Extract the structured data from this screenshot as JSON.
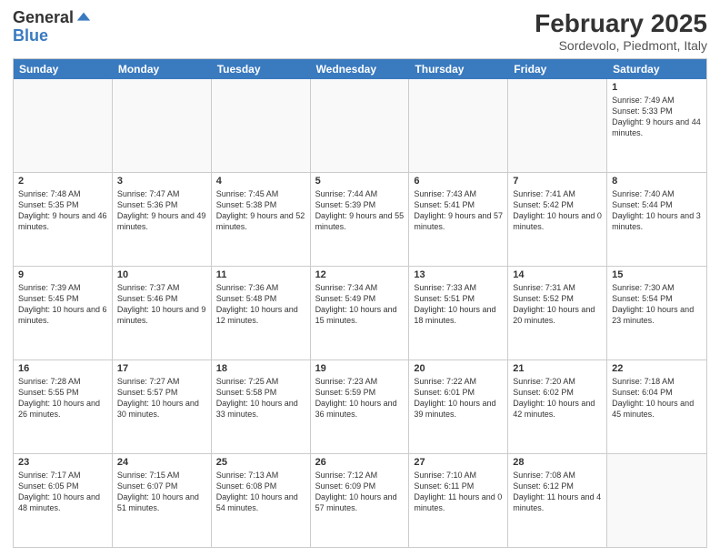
{
  "header": {
    "logo_general": "General",
    "logo_blue": "Blue",
    "title": "February 2025",
    "location": "Sordevolo, Piedmont, Italy"
  },
  "weekdays": [
    "Sunday",
    "Monday",
    "Tuesday",
    "Wednesday",
    "Thursday",
    "Friday",
    "Saturday"
  ],
  "rows": [
    [
      {
        "day": "",
        "info": ""
      },
      {
        "day": "",
        "info": ""
      },
      {
        "day": "",
        "info": ""
      },
      {
        "day": "",
        "info": ""
      },
      {
        "day": "",
        "info": ""
      },
      {
        "day": "",
        "info": ""
      },
      {
        "day": "1",
        "info": "Sunrise: 7:49 AM\nSunset: 5:33 PM\nDaylight: 9 hours and 44 minutes."
      }
    ],
    [
      {
        "day": "2",
        "info": "Sunrise: 7:48 AM\nSunset: 5:35 PM\nDaylight: 9 hours and 46 minutes."
      },
      {
        "day": "3",
        "info": "Sunrise: 7:47 AM\nSunset: 5:36 PM\nDaylight: 9 hours and 49 minutes."
      },
      {
        "day": "4",
        "info": "Sunrise: 7:45 AM\nSunset: 5:38 PM\nDaylight: 9 hours and 52 minutes."
      },
      {
        "day": "5",
        "info": "Sunrise: 7:44 AM\nSunset: 5:39 PM\nDaylight: 9 hours and 55 minutes."
      },
      {
        "day": "6",
        "info": "Sunrise: 7:43 AM\nSunset: 5:41 PM\nDaylight: 9 hours and 57 minutes."
      },
      {
        "day": "7",
        "info": "Sunrise: 7:41 AM\nSunset: 5:42 PM\nDaylight: 10 hours and 0 minutes."
      },
      {
        "day": "8",
        "info": "Sunrise: 7:40 AM\nSunset: 5:44 PM\nDaylight: 10 hours and 3 minutes."
      }
    ],
    [
      {
        "day": "9",
        "info": "Sunrise: 7:39 AM\nSunset: 5:45 PM\nDaylight: 10 hours and 6 minutes."
      },
      {
        "day": "10",
        "info": "Sunrise: 7:37 AM\nSunset: 5:46 PM\nDaylight: 10 hours and 9 minutes."
      },
      {
        "day": "11",
        "info": "Sunrise: 7:36 AM\nSunset: 5:48 PM\nDaylight: 10 hours and 12 minutes."
      },
      {
        "day": "12",
        "info": "Sunrise: 7:34 AM\nSunset: 5:49 PM\nDaylight: 10 hours and 15 minutes."
      },
      {
        "day": "13",
        "info": "Sunrise: 7:33 AM\nSunset: 5:51 PM\nDaylight: 10 hours and 18 minutes."
      },
      {
        "day": "14",
        "info": "Sunrise: 7:31 AM\nSunset: 5:52 PM\nDaylight: 10 hours and 20 minutes."
      },
      {
        "day": "15",
        "info": "Sunrise: 7:30 AM\nSunset: 5:54 PM\nDaylight: 10 hours and 23 minutes."
      }
    ],
    [
      {
        "day": "16",
        "info": "Sunrise: 7:28 AM\nSunset: 5:55 PM\nDaylight: 10 hours and 26 minutes."
      },
      {
        "day": "17",
        "info": "Sunrise: 7:27 AM\nSunset: 5:57 PM\nDaylight: 10 hours and 30 minutes."
      },
      {
        "day": "18",
        "info": "Sunrise: 7:25 AM\nSunset: 5:58 PM\nDaylight: 10 hours and 33 minutes."
      },
      {
        "day": "19",
        "info": "Sunrise: 7:23 AM\nSunset: 5:59 PM\nDaylight: 10 hours and 36 minutes."
      },
      {
        "day": "20",
        "info": "Sunrise: 7:22 AM\nSunset: 6:01 PM\nDaylight: 10 hours and 39 minutes."
      },
      {
        "day": "21",
        "info": "Sunrise: 7:20 AM\nSunset: 6:02 PM\nDaylight: 10 hours and 42 minutes."
      },
      {
        "day": "22",
        "info": "Sunrise: 7:18 AM\nSunset: 6:04 PM\nDaylight: 10 hours and 45 minutes."
      }
    ],
    [
      {
        "day": "23",
        "info": "Sunrise: 7:17 AM\nSunset: 6:05 PM\nDaylight: 10 hours and 48 minutes."
      },
      {
        "day": "24",
        "info": "Sunrise: 7:15 AM\nSunset: 6:07 PM\nDaylight: 10 hours and 51 minutes."
      },
      {
        "day": "25",
        "info": "Sunrise: 7:13 AM\nSunset: 6:08 PM\nDaylight: 10 hours and 54 minutes."
      },
      {
        "day": "26",
        "info": "Sunrise: 7:12 AM\nSunset: 6:09 PM\nDaylight: 10 hours and 57 minutes."
      },
      {
        "day": "27",
        "info": "Sunrise: 7:10 AM\nSunset: 6:11 PM\nDaylight: 11 hours and 0 minutes."
      },
      {
        "day": "28",
        "info": "Sunrise: 7:08 AM\nSunset: 6:12 PM\nDaylight: 11 hours and 4 minutes."
      },
      {
        "day": "",
        "info": ""
      }
    ]
  ]
}
